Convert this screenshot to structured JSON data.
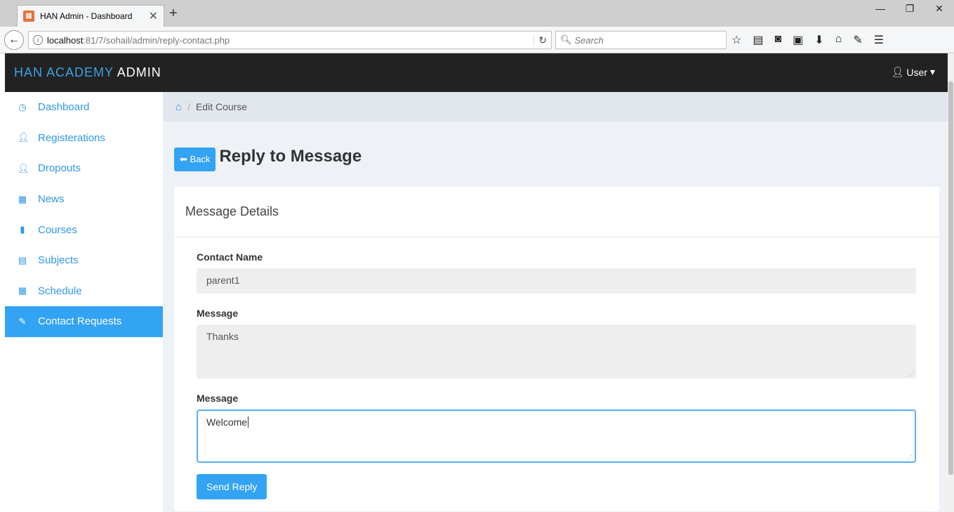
{
  "browser": {
    "tab_title": "HAN Admin - Dashboard",
    "url_host": "localhost",
    "url_path": ":81/7/sohail/admin/reply-contact.php",
    "search_placeholder": "Search"
  },
  "header": {
    "brand_first": "HAN ACADEMY",
    "brand_second": "ADMIN",
    "user_label": "User"
  },
  "sidebar": {
    "items": [
      {
        "label": "Dashboard",
        "icon": "dashboard-icon"
      },
      {
        "label": "Registerations",
        "icon": "user-icon"
      },
      {
        "label": "Dropouts",
        "icon": "user-icon"
      },
      {
        "label": "News",
        "icon": "grid-icon"
      },
      {
        "label": "Courses",
        "icon": "bar-chart-icon"
      },
      {
        "label": "Subjects",
        "icon": "list-icon"
      },
      {
        "label": "Schedule",
        "icon": "grid-icon"
      },
      {
        "label": "Contact Requests",
        "icon": "pencil-icon",
        "active": true
      }
    ]
  },
  "breadcrumb": {
    "current": "Edit Course"
  },
  "page": {
    "back_label": "Back",
    "title": "Reply to Message"
  },
  "panel": {
    "heading": "Message Details",
    "contact_name_label": "Contact Name",
    "contact_name_value": "parent1",
    "message_label": "Message",
    "message_value": "Thanks",
    "reply_label": "Message",
    "reply_value": "Welcome",
    "send_label": "Send Reply"
  },
  "colors": {
    "accent": "#33a3f4",
    "header_bg": "#222222",
    "brand_blue": "#3aa3e3"
  }
}
